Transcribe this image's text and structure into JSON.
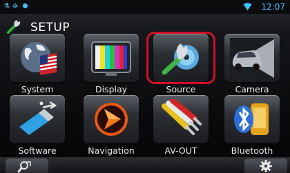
{
  "status_bar": {
    "icons": [
      "usb-icon",
      "settings-icon",
      "notification-icon",
      "wifi-icon"
    ],
    "time": "12:07"
  },
  "header": {
    "icon": "wrench-icon",
    "title": "SETUP"
  },
  "tiles": [
    {
      "label": "System",
      "icon": "globe-flag-icon"
    },
    {
      "label": "Display",
      "icon": "color-bars-tv-icon"
    },
    {
      "label": "Source",
      "icon": "wrench-disc-icon",
      "selected": true
    },
    {
      "label": "Camera",
      "icon": "car-camera-icon"
    },
    {
      "label": "Software",
      "icon": "usb-drive-icon"
    },
    {
      "label": "Navigation",
      "icon": "navigation-arrow-icon"
    },
    {
      "label": "AV-OUT",
      "icon": "rca-cables-icon"
    },
    {
      "label": "Bluetooth",
      "icon": "bluetooth-phone-icon"
    }
  ],
  "bottom_bar": {
    "left_button": "search-zoom-icon",
    "right_button": "gear-icon"
  },
  "colors": {
    "accent": "#3ec3ff",
    "highlight": "#d0102a"
  }
}
